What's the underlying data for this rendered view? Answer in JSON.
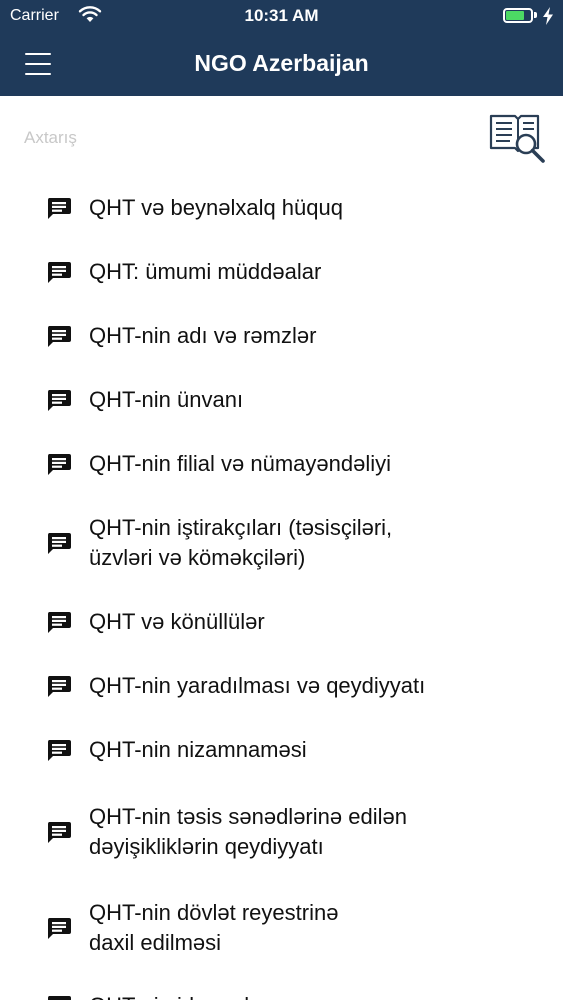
{
  "status_bar": {
    "carrier": "Carrier",
    "time": "10:31 AM",
    "battery_level": 0.75,
    "battery_color": "#4cd964"
  },
  "nav": {
    "title": "NGO Azerbaijan",
    "background": "#1f3a5a",
    "menu_icon": "hamburger-icon"
  },
  "search": {
    "placeholder": "Axtarış",
    "value": "",
    "button_icon": "book-search-icon"
  },
  "topics": [
    {
      "label": "QHT və beynəlxalq hüquq",
      "icon": "message-icon"
    },
    {
      "label": "QHT: ümumi müddəalar",
      "icon": "message-icon"
    },
    {
      "label": "QHT-nin adı və rəmzlər",
      "icon": "message-icon"
    },
    {
      "label": "QHT-nin ünvanı",
      "icon": "message-icon"
    },
    {
      "label": "QHT-nin filial və nümayəndəliyi",
      "icon": "message-icon"
    },
    {
      "label": "QHT-nin iştirakçıları (təsisçiləri,\nüzvləri və köməkçiləri)",
      "icon": "message-icon"
    },
    {
      "label": "QHT və könüllülər",
      "icon": "message-icon"
    },
    {
      "label": "QHT-nin yaradılması və qeydiyyatı",
      "icon": "message-icon"
    },
    {
      "label": "QHT-nin nizamnaməsi",
      "icon": "message-icon"
    },
    {
      "label": "QHT-nin təsis sənədlərinə edilən\ndəyişikliklərin qeydiyyatı",
      "icon": "message-icon"
    },
    {
      "label": "QHT-nin dövlət reyestrinə\ndaxil edilməsi",
      "icon": "message-icon"
    },
    {
      "label": "QHT-nin idarə olunması",
      "icon": "message-icon"
    }
  ]
}
